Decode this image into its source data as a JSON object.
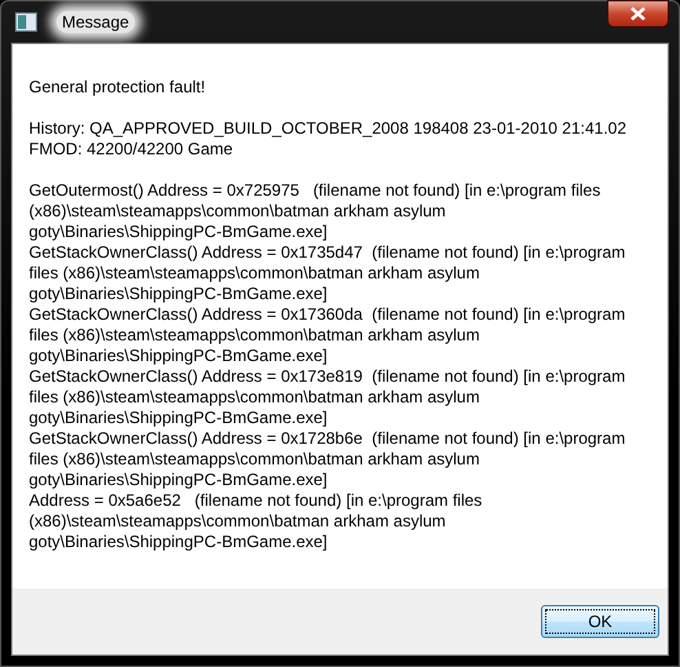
{
  "window": {
    "title": "Message"
  },
  "paragraphs": [
    [
      "General protection fault!"
    ],
    [
      "History: QA_APPROVED_BUILD_OCTOBER_2008 198408 23-01-2010 21:41.02",
      "FMOD: 42200/42200 Game"
    ],
    [
      "GetOutermost() Address = 0x725975   (filename not found) [in e:\\program files",
      "(x86)\\steam\\steamapps\\common\\batman arkham asylum",
      "goty\\Binaries\\ShippingPC-BmGame.exe]",
      "GetStackOwnerClass() Address = 0x1735d47  (filename not found) [in e:\\program",
      "files (x86)\\steam\\steamapps\\common\\batman arkham asylum",
      "goty\\Binaries\\ShippingPC-BmGame.exe]",
      "GetStackOwnerClass() Address = 0x17360da  (filename not found) [in e:\\program",
      "files (x86)\\steam\\steamapps\\common\\batman arkham asylum",
      "goty\\Binaries\\ShippingPC-BmGame.exe]",
      "GetStackOwnerClass() Address = 0x173e819  (filename not found) [in e:\\program",
      "files (x86)\\steam\\steamapps\\common\\batman arkham asylum",
      "goty\\Binaries\\ShippingPC-BmGame.exe]",
      "GetStackOwnerClass() Address = 0x1728b6e  (filename not found) [in e:\\program",
      "files (x86)\\steam\\steamapps\\common\\batman arkham asylum",
      "goty\\Binaries\\ShippingPC-BmGame.exe]",
      "Address = 0x5a6e52   (filename not found) [in e:\\program files",
      "(x86)\\steam\\steamapps\\common\\batman arkham asylum",
      "goty\\Binaries\\ShippingPC-BmGame.exe]"
    ]
  ],
  "button": {
    "label": "OK",
    "focused": true
  }
}
